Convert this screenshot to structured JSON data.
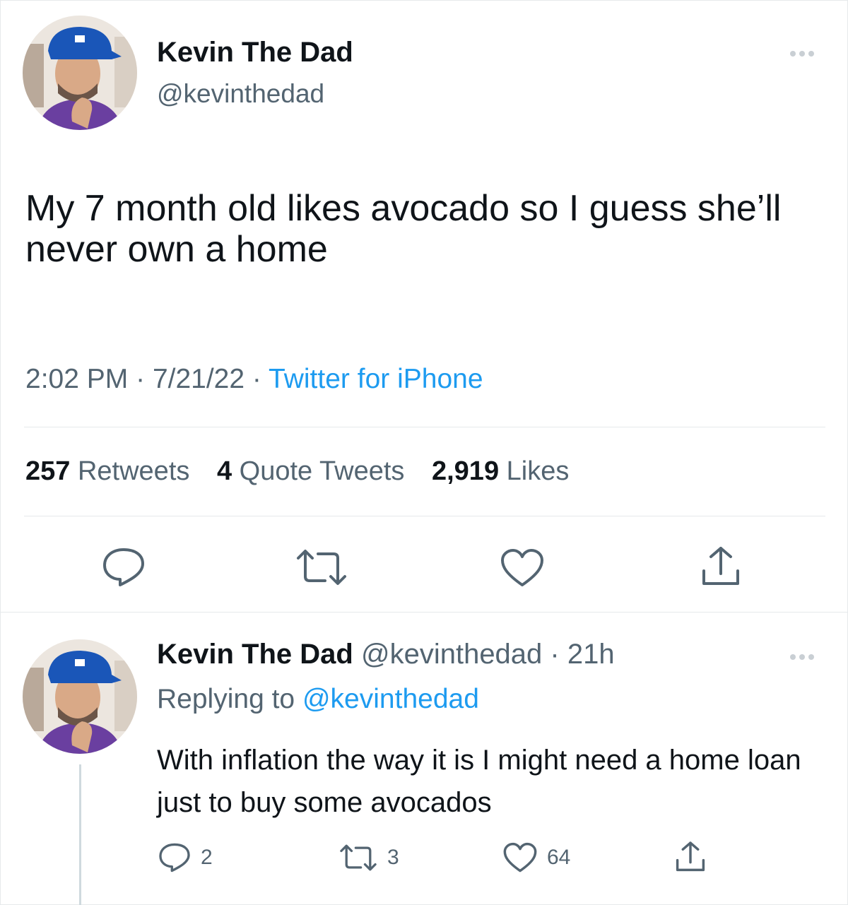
{
  "main_tweet": {
    "display_name": "Kevin The Dad",
    "handle": "@kevinthedad",
    "text": "My 7 month old likes avocado so I guess she’ll never own a home",
    "time": "2:02 PM",
    "separator": "·",
    "date": "7/21/22",
    "source": "Twitter for iPhone",
    "stats": {
      "retweets_count": "257",
      "retweets_label": "Retweets",
      "quotes_count": "4",
      "quotes_label": "Quote Tweets",
      "likes_count": "2,919",
      "likes_label": "Likes"
    },
    "actions": [
      "reply-icon",
      "retweet-icon",
      "like-icon",
      "share-icon"
    ]
  },
  "reply_tweet": {
    "display_name": "Kevin The Dad",
    "handle": "@kevinthedad",
    "separator": "·",
    "age": "21h",
    "replying_prefix": "Replying to",
    "replying_to": "@kevinthedad",
    "text": "With inflation the way it is I might need a home loan just to buy some avocados",
    "reply_count": "2",
    "retweet_count": "3",
    "like_count": "64"
  },
  "colors": {
    "text_primary": "#0f1419",
    "text_secondary": "#536471",
    "link": "#1d9bf0",
    "divider": "#e6e9eb",
    "hat": "#1a56b8"
  }
}
